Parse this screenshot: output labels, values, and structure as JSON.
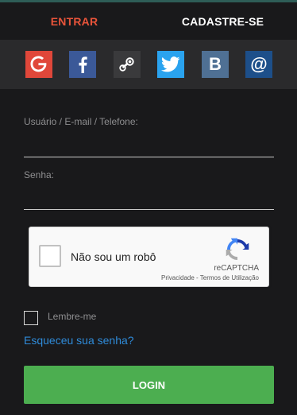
{
  "tabs": {
    "login_label": "ENTRAR",
    "register_label": "CADASTRE-SE"
  },
  "social": [
    {
      "icon": "google-icon",
      "glyph": "G",
      "color": "#e0473a"
    },
    {
      "icon": "facebook-icon",
      "glyph": "f",
      "color": "#3b5998"
    },
    {
      "icon": "steam-icon",
      "glyph": "",
      "color": "#3a3a3c"
    },
    {
      "icon": "twitter-icon",
      "glyph": "",
      "color": "#2aa3ef"
    },
    {
      "icon": "vk-icon",
      "glyph": "B",
      "color": "#4f7094"
    },
    {
      "icon": "mail-icon",
      "glyph": "@",
      "color": "#1d4f8a"
    }
  ],
  "form": {
    "username_label": "Usuário / E-mail / Telefone:",
    "username_value": "",
    "password_label": "Senha:",
    "password_value": ""
  },
  "captcha": {
    "text": "Não sou um robô",
    "brand": "reCAPTCHA",
    "terms": "Privacidade - Termos de Utilização"
  },
  "remember": {
    "label": "Lembre-me",
    "checked": false
  },
  "forgot_link": "Esqueceu sua senha?",
  "login_button": "LOGIN",
  "colors": {
    "accent": "#e8543a",
    "button": "#4cae50",
    "link": "#2f8bd9",
    "background": "#19191b"
  }
}
